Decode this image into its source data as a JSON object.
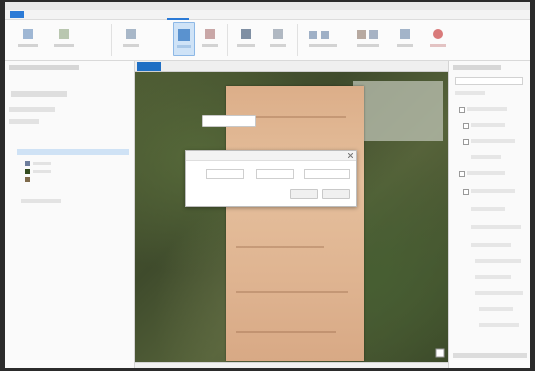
{
  "window": {
    "title": ""
  },
  "tabs": [
    {
      "label": ""
    },
    {
      "label": ""
    },
    {
      "label": ""
    },
    {
      "label": ""
    },
    {
      "label": ""
    },
    {
      "label": ""
    },
    {
      "label": ""
    },
    {
      "label": ""
    }
  ],
  "ribbon": {
    "buttons": [
      {
        "icon": "tool-icon",
        "label": "",
        "active": false
      },
      {
        "icon": "tool-icon",
        "label": "",
        "active": false
      },
      {
        "icon": "tool-icon",
        "label": "",
        "active": false
      },
      {
        "icon": "georeference-icon",
        "label": "",
        "active": true
      },
      {
        "icon": "tool-icon",
        "label": "",
        "active": false
      },
      {
        "icon": "tool-icon",
        "label": "",
        "active": false
      },
      {
        "icon": "tool-icon",
        "label": "",
        "active": false
      },
      {
        "icon": "tool-icon",
        "label": "",
        "active": false
      },
      {
        "icon": "tool-icon",
        "label": "",
        "active": false
      },
      {
        "icon": "close-icon",
        "label": "",
        "active": false
      }
    ]
  },
  "left_panel": {
    "title": "",
    "items": [
      {
        "label": ""
      },
      {
        "label": ""
      },
      {
        "label": ""
      }
    ]
  },
  "map": {
    "tab_label": "",
    "callout": ""
  },
  "dialog": {
    "title": "",
    "fields": [
      "",
      "",
      ""
    ],
    "buttons": [
      "",
      ""
    ]
  },
  "right_panel": {
    "title": "",
    "items": [
      {
        "label": ""
      },
      {
        "label": ""
      },
      {
        "label": ""
      },
      {
        "label": ""
      },
      {
        "label": ""
      }
    ]
  },
  "colors": {
    "accent": "#1f6fc4",
    "imagery_green": "#4d5a33",
    "scan_tan": "#dfb491"
  }
}
